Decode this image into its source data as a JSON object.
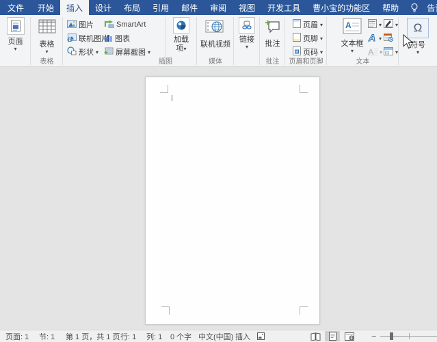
{
  "colors": {
    "accent": "#2b579a",
    "tab_text": "#ffffff",
    "ribbon_bg": "#f3f4f5",
    "doc_bg": "#e4e4e4",
    "page_bg": "#fefefe",
    "statusbar_bg": "#f0f0f0"
  },
  "tabs": {
    "items": [
      {
        "label": "文件",
        "active": false
      },
      {
        "label": "开始",
        "active": false
      },
      {
        "label": "插入",
        "active": true
      },
      {
        "label": "设计",
        "active": false
      },
      {
        "label": "布局",
        "active": false
      },
      {
        "label": "引用",
        "active": false
      },
      {
        "label": "邮件",
        "active": false
      },
      {
        "label": "审阅",
        "active": false
      },
      {
        "label": "视图",
        "active": false
      },
      {
        "label": "开发工具",
        "active": false
      },
      {
        "label": "曹小宝的功能区",
        "active": false
      },
      {
        "label": "帮助",
        "active": false
      }
    ],
    "tell_me": "告诉我"
  },
  "ribbon": {
    "groups": {
      "pages": {
        "button": "页面",
        "label": ""
      },
      "tables": {
        "button": "表格",
        "label": "表格"
      },
      "illustrations": {
        "label": "插图",
        "items": [
          {
            "label": "图片"
          },
          {
            "label": "联机图片"
          },
          {
            "label": "形状"
          },
          {
            "label": "SmartArt"
          },
          {
            "label": "图表"
          },
          {
            "label": "屏幕截图"
          }
        ]
      },
      "addins": {
        "button_line1": "加载",
        "button_line2": "项",
        "label": ""
      },
      "media": {
        "button": "联机视频",
        "label": "媒体"
      },
      "links": {
        "button": "链接",
        "label": ""
      },
      "comments": {
        "button": "批注",
        "label": "批注"
      },
      "header_footer": {
        "label": "页眉和页脚",
        "items": [
          {
            "label": "页眉"
          },
          {
            "label": "页脚"
          },
          {
            "label": "页码"
          }
        ]
      },
      "text": {
        "label": "文本",
        "textbox": "文本框",
        "icons": [
          "quick-parts",
          "signature-line",
          "wordart",
          "date-time",
          "drop-cap",
          "object"
        ]
      },
      "symbols": {
        "button": "符号",
        "omega": "Ω",
        "label": ""
      }
    }
  },
  "status_bar": {
    "page": "页面: 1",
    "section": "节: 1",
    "page_of": "第 1 页，共 1 页",
    "line": "行: 1",
    "column": "列: 1",
    "word_count": "0 个字",
    "language": "中文(中国)",
    "input_mode": "插入",
    "active_view": "print-layout"
  },
  "icon_names": [
    "page-icon",
    "table-icon",
    "picture-icon",
    "online-picture-icon",
    "shapes-icon",
    "smartart-icon",
    "chart-icon",
    "screenshot-icon",
    "add-ins-icon",
    "online-video-icon",
    "link-icon",
    "comment-icon",
    "header-icon",
    "footer-icon",
    "page-number-icon",
    "textbox-icon",
    "quick-parts-icon",
    "signature-line-icon",
    "wordart-icon",
    "date-time-icon",
    "drop-cap-icon",
    "object-icon",
    "omega-symbol",
    "lightbulb-icon",
    "chevron-down-icon",
    "mouse-cursor",
    "macro-record-icon",
    "read-mode-icon",
    "print-layout-icon",
    "web-layout-icon",
    "zoom-out-icon",
    "zoom-slider"
  ]
}
